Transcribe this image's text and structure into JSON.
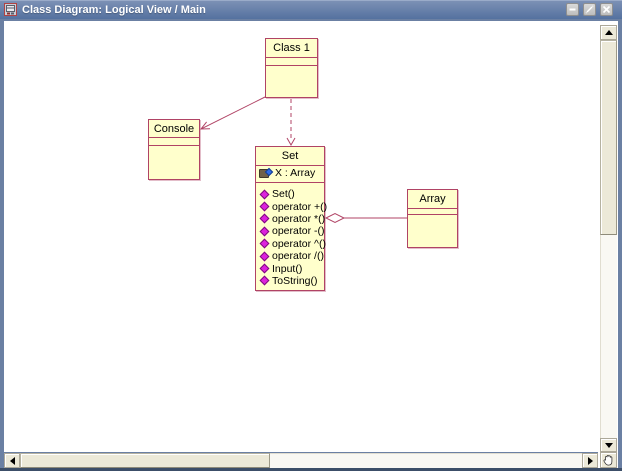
{
  "window": {
    "icon": "class-diagram-icon",
    "title": "Class Diagram: Logical View / Main",
    "controls": [
      {
        "name": "minimize",
        "icon": "minimize-icon"
      },
      {
        "name": "restore",
        "icon": "restore-icon"
      },
      {
        "name": "close",
        "icon": "close-icon"
      }
    ]
  },
  "diagram": {
    "classes": [
      {
        "name": "Class 1"
      },
      {
        "name": "Console"
      },
      {
        "name": "Set",
        "attributes": [
          {
            "icon": "attribute-icon",
            "label": "X : Array"
          }
        ],
        "operations": [
          {
            "icon": "public-operation-icon",
            "label": "Set()"
          },
          {
            "icon": "public-operation-icon",
            "label": "operator +()"
          },
          {
            "icon": "public-operation-icon",
            "label": "operator *()"
          },
          {
            "icon": "public-operation-icon",
            "label": "operator -()"
          },
          {
            "icon": "public-operation-icon",
            "label": "operator ^()"
          },
          {
            "icon": "public-operation-icon",
            "label": "operator /()"
          },
          {
            "icon": "public-operation-icon",
            "label": "Input()"
          },
          {
            "icon": "public-operation-icon",
            "label": "ToString()"
          }
        ]
      },
      {
        "name": "Array"
      }
    ],
    "relations": [
      {
        "type": "association",
        "from": "Class 1",
        "to": "Console"
      },
      {
        "type": "dependency",
        "from": "Class 1",
        "to": "Set"
      },
      {
        "type": "aggregation",
        "whole": "Set",
        "part": "Array"
      }
    ]
  },
  "colors": {
    "titlebar_top": "#7e92b6",
    "titlebar_bottom": "#54719f",
    "window_border": "#6b80a3",
    "canvas_bg": "#ffffff",
    "class_fill": "#ffffcc",
    "class_border": "#b04365",
    "relation_line": "#b04365",
    "operation_icon": "#dd22dd",
    "attribute_icon_diamond": "#2f6ce6",
    "scrollbar_face": "#ece9d8"
  }
}
